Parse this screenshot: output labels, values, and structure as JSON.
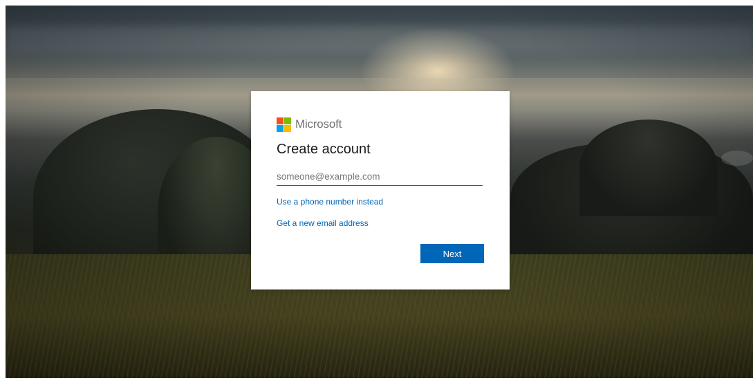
{
  "brand": {
    "name": "Microsoft",
    "logo_colors": [
      "#f25022",
      "#7fba00",
      "#00a4ef",
      "#ffb900"
    ]
  },
  "form": {
    "title": "Create account",
    "email_placeholder": "someone@example.com",
    "email_value": "",
    "phone_link": "Use a phone number instead",
    "new_email_link": "Get a new email address",
    "next_label": "Next"
  },
  "colors": {
    "accent": "#0067b8",
    "card_background": "#ffffff"
  }
}
